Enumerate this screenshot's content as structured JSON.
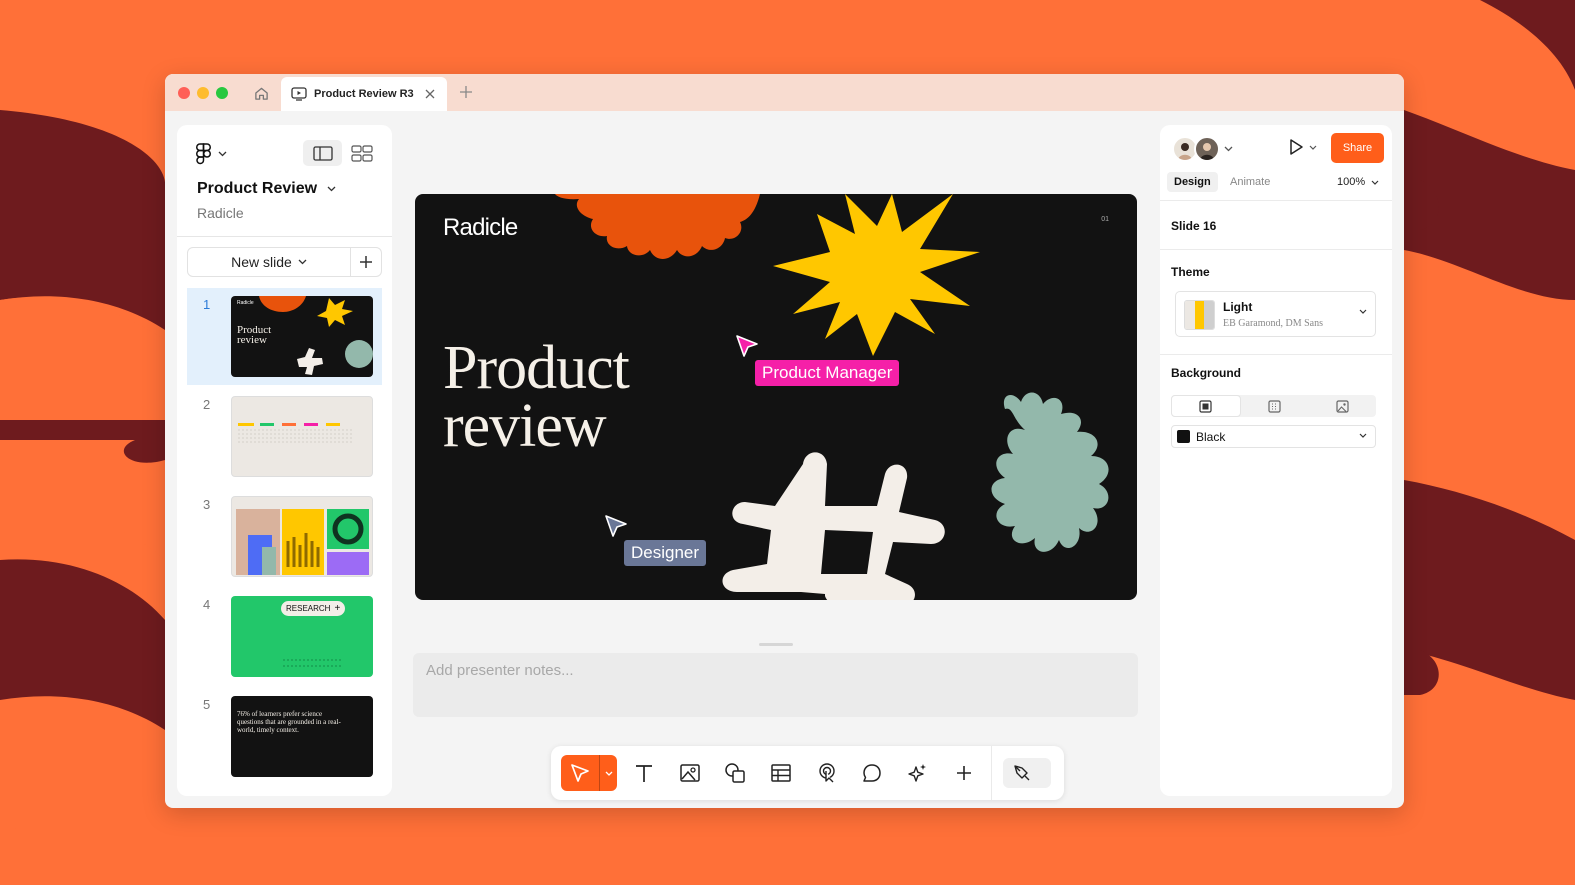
{
  "window": {
    "tab_title": "Product Review R3"
  },
  "left_panel": {
    "project_title": "Product Review",
    "project_subtitle": "Radicle",
    "new_slide_label": "New slide",
    "slides": [
      {
        "number": "1",
        "thumb_text": "Product review",
        "thumb_brand": "Radicle",
        "selected": true
      },
      {
        "number": "2"
      },
      {
        "number": "3"
      },
      {
        "number": "4",
        "thumb_badge": "RESEARCH"
      },
      {
        "number": "5",
        "thumb_text": "76% of learners prefer science questions that are grounded in a real-world, timely context."
      }
    ]
  },
  "canvas": {
    "brand": "Radicle",
    "page_number": "01",
    "hero_line1": "Product",
    "hero_line2": "review",
    "cursor_pm_label": "Product Manager",
    "cursor_designer_label": "Designer",
    "notes_placeholder": "Add presenter notes..."
  },
  "toolbar": {
    "tools": [
      "select-icon",
      "text-icon",
      "image-icon",
      "shapes-icon",
      "table-icon",
      "interaction-icon",
      "comment-icon",
      "ai-sparkle-icon",
      "add-icon",
      "pen-icon"
    ]
  },
  "right_panel": {
    "share_label": "Share",
    "tabs": {
      "design": "Design",
      "animate": "Animate"
    },
    "zoom": "100%",
    "slide_label": "Slide 16",
    "theme_title": "Theme",
    "theme_name": "Light",
    "theme_fonts": "EB Garamond, DM Sans",
    "background_title": "Background",
    "background_value": "Black"
  },
  "colors": {
    "page_bg": "#FF7038",
    "accent": "#FF5E1A",
    "pm_cursor": "#F520A8",
    "designer_cursor": "#6A7797",
    "slide_bg": "#121212",
    "shape_orange": "#E8530C",
    "shape_yellow": "#FFC700",
    "shape_sage": "#93B8AB",
    "shape_cream": "#F3EEE8"
  }
}
